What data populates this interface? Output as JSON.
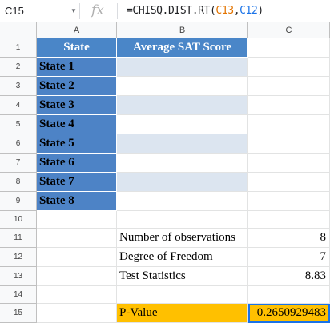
{
  "formula_bar": {
    "cell_ref": "C15",
    "fx_label": "fx",
    "formula_prefix": "=CHISQ.DIST.RT(",
    "formula_arg1": "C13",
    "formula_sep": ",",
    "formula_arg2": "C12",
    "formula_suffix": ")"
  },
  "columns": [
    "A",
    "B",
    "C"
  ],
  "rows": [
    "1",
    "2",
    "3",
    "4",
    "5",
    "6",
    "7",
    "8",
    "9",
    "10",
    "11",
    "12",
    "13",
    "14",
    "15"
  ],
  "table": {
    "header_state": "State",
    "header_sat": "Average SAT Score",
    "states": [
      "State 1",
      "State 2",
      "State 3",
      "State 4",
      "State 5",
      "State 6",
      "State 7",
      "State 8"
    ]
  },
  "stats": {
    "obs_label": "Number of observations",
    "obs_value": "8",
    "dof_label": "Degree of Freedom",
    "dof_value": "7",
    "ts_label": "Test Statistics",
    "ts_value": "8.83",
    "pvalue_label": "P-Value",
    "pvalue_value": "0.2650929483"
  },
  "colors": {
    "header_blue": "#4a86c8",
    "state_blue": "#4d83c6",
    "light_blue": "#dce5f0",
    "gold": "#ffc000",
    "selection": "#1a73e8"
  }
}
